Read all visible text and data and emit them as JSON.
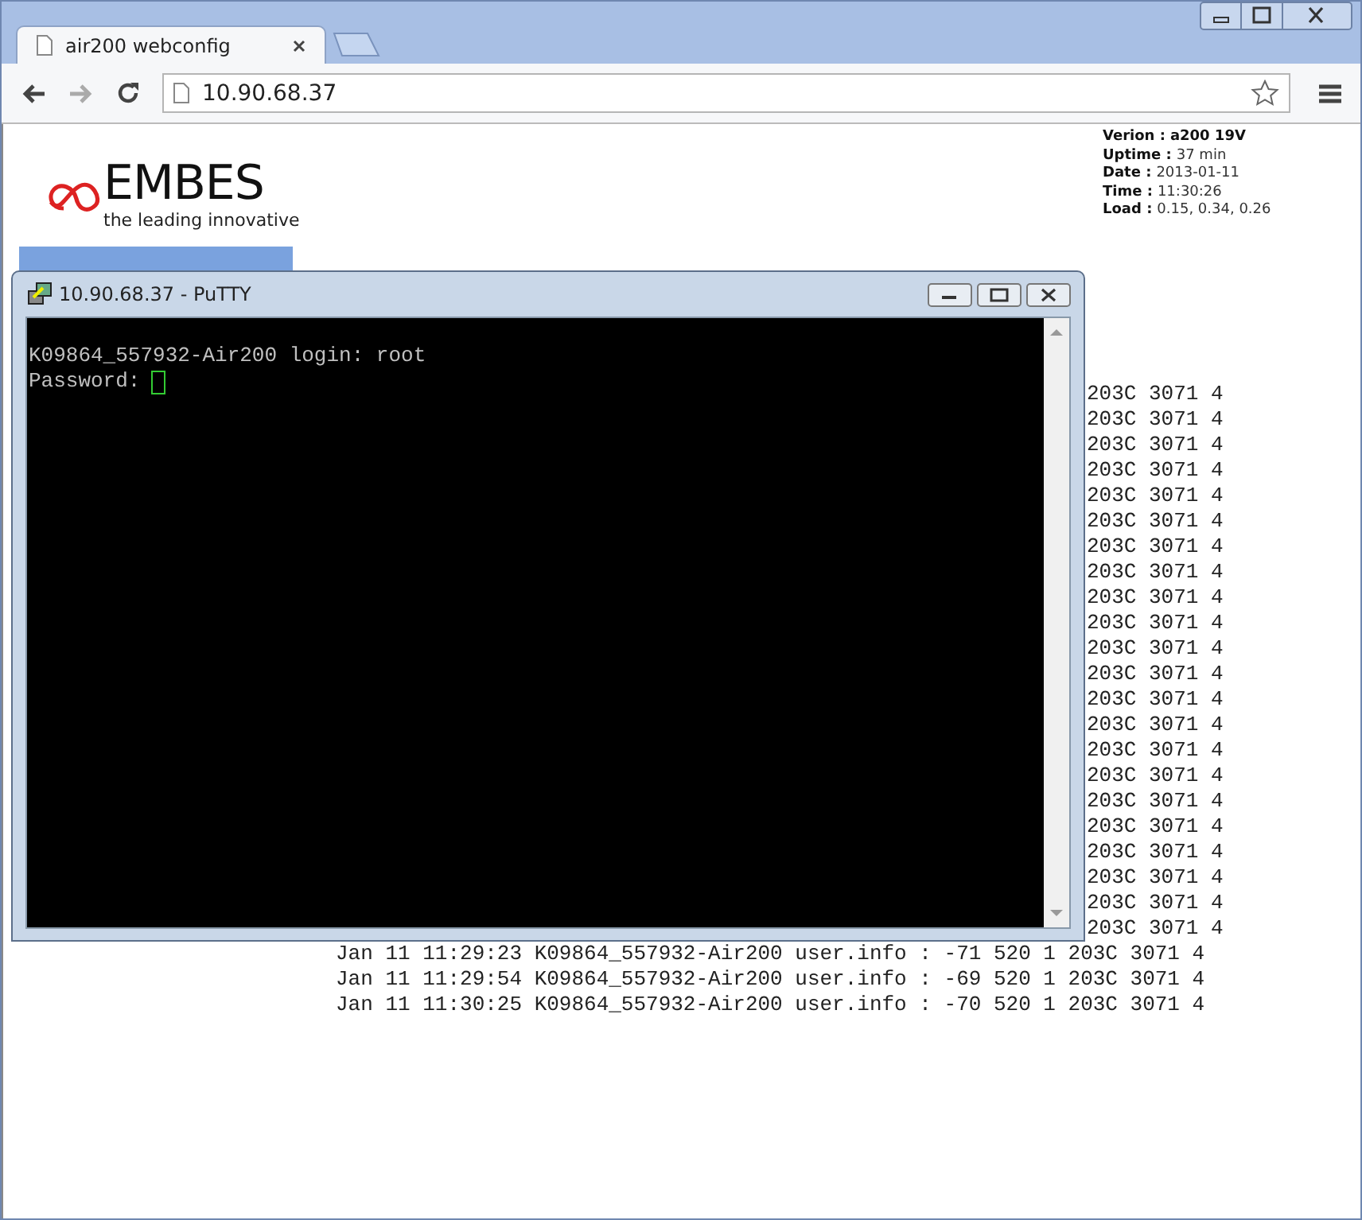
{
  "browser": {
    "tabs": [
      {
        "title": "air200 webconfig",
        "selected": true
      }
    ],
    "address": "10.90.68.37"
  },
  "page": {
    "logo": {
      "name": "EMBES",
      "tagline": "the leading innovative"
    },
    "status": [
      {
        "label": "Verion :",
        "value": "a200 19V",
        "bold": true
      },
      {
        "label": "Uptime :",
        "value": "37 min",
        "bold": false
      },
      {
        "label": "Date :",
        "value": "2013-01-11",
        "bold": false
      },
      {
        "label": "Time :",
        "value": "11:30:26",
        "bold": false
      },
      {
        "label": "Load :",
        "value": "0.15, 0.34, 0.26",
        "bold": false
      }
    ],
    "nav": [
      {
        "selected": true
      }
    ],
    "log": [
      {
        "kind": "tail",
        "text": "203C 3071 4"
      },
      {
        "kind": "tail",
        "text": "203C 3071 4"
      },
      {
        "kind": "tail",
        "text": "203C 3071 4"
      },
      {
        "kind": "tail",
        "text": "203C 3071 4"
      },
      {
        "kind": "tail",
        "text": "203C 3071 4"
      },
      {
        "kind": "tail",
        "text": "203C 3071 4"
      },
      {
        "kind": "tail",
        "text": "203C 3071 4"
      },
      {
        "kind": "tail",
        "text": "203C 3071 4"
      },
      {
        "kind": "tail",
        "text": "203C 3071 4"
      },
      {
        "kind": "tail",
        "text": "203C 3071 4"
      },
      {
        "kind": "tail",
        "text": "203C 3071 4"
      },
      {
        "kind": "tail",
        "text": "203C 3071 4"
      },
      {
        "kind": "tail",
        "text": "203C 3071 4"
      },
      {
        "kind": "tail",
        "text": "203C 3071 4"
      },
      {
        "kind": "tail",
        "text": "203C 3071 4"
      },
      {
        "kind": "tail",
        "text": "203C 3071 4"
      },
      {
        "kind": "tail",
        "text": "203C 3071 4"
      },
      {
        "kind": "tail",
        "text": "203C 3071 4"
      },
      {
        "kind": "tail",
        "text": "203C 3071 4"
      },
      {
        "kind": "tail",
        "text": "203C 3071 4"
      },
      {
        "kind": "tail",
        "text": "203C 3071 4"
      },
      {
        "kind": "tail",
        "text": "203C 3071 4"
      },
      {
        "kind": "full",
        "text": "Jan 11 11:29:23 K09864_557932-Air200 user.info : -71 520 1 203C 3071 4"
      },
      {
        "kind": "full",
        "text": "Jan 11 11:29:54 K09864_557932-Air200 user.info : -69 520 1 203C 3071 4"
      },
      {
        "kind": "full",
        "text": "Jan 11 11:30:25 K09864_557932-Air200 user.info : -70 520 1 203C 3071 4"
      }
    ]
  },
  "putty": {
    "title": "10.90.68.37 - PuTTY",
    "lines": [
      "K09864_557932-Air200 login: root",
      "Password:"
    ]
  }
}
